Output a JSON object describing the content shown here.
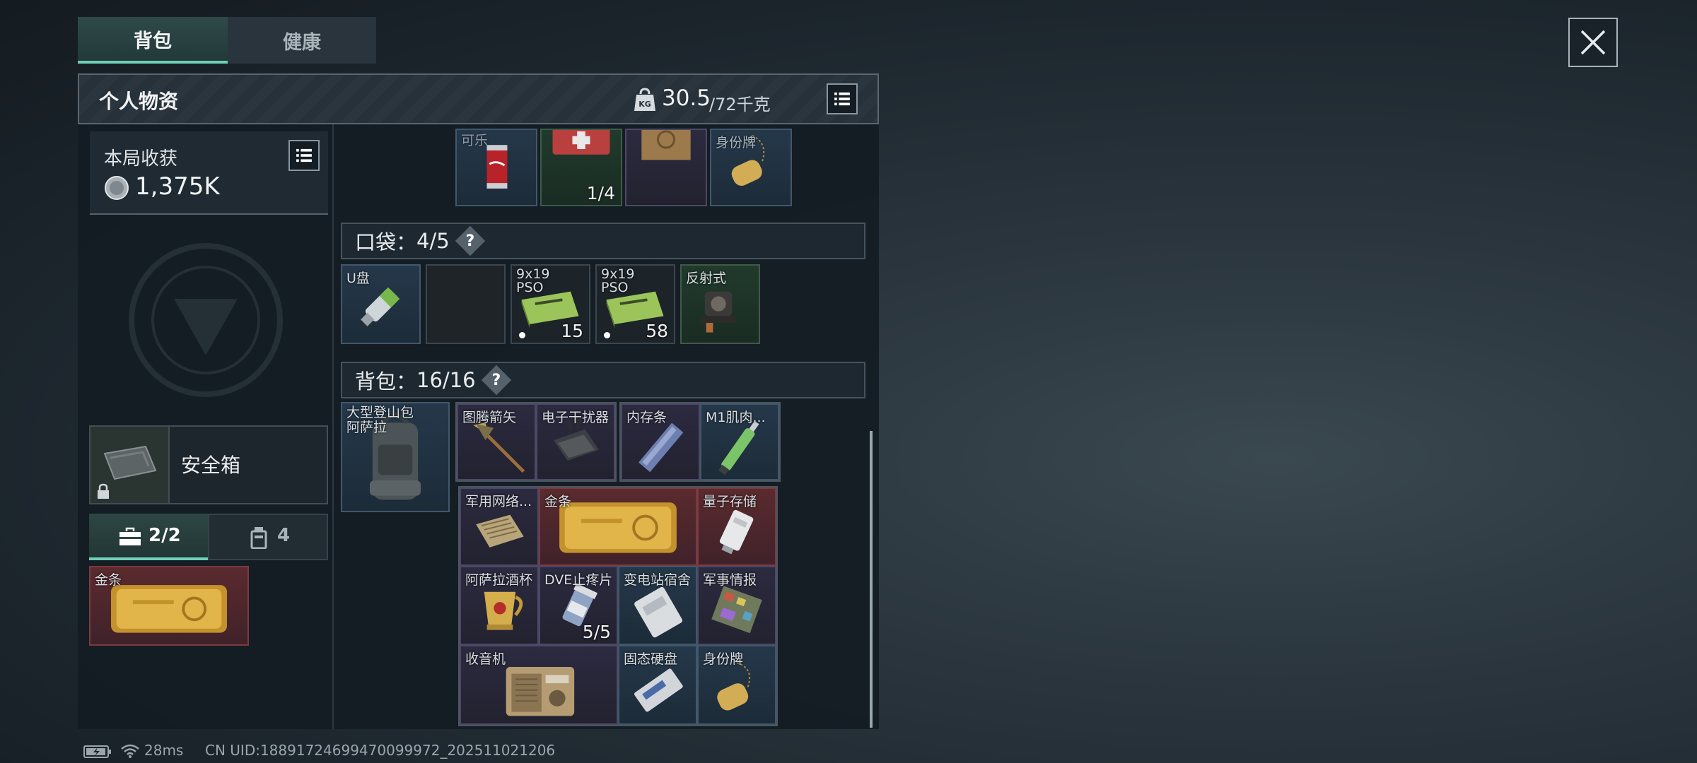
{
  "tabs": [
    {
      "label": "背包",
      "active": true
    },
    {
      "label": "健康",
      "active": false
    }
  ],
  "header": {
    "title": "个人物资",
    "weight_current": "30.5",
    "weight_max": "/72千克",
    "weight_icon": "kg-weight-icon"
  },
  "loot": {
    "label": "本局收获",
    "value": "1,375K"
  },
  "safebox": {
    "label": "安全箱"
  },
  "container_tabs": [
    {
      "value": "2/2",
      "icon": "toolbox-icon",
      "active": true
    },
    {
      "value": "4",
      "icon": "canister-icon",
      "active": false
    }
  ],
  "container_items": [
    {
      "label": "金条",
      "quality": "red"
    }
  ],
  "top_items": [
    {
      "label": "可乐",
      "count": "",
      "quality": "blue"
    },
    {
      "label": "",
      "count": "1/4",
      "quality": "green"
    },
    {
      "label": "",
      "count": "",
      "quality": "purple"
    },
    {
      "label": "身份牌",
      "count": "",
      "quality": "blue"
    }
  ],
  "pockets": {
    "label": "口袋：",
    "value": "4/5",
    "help": "?",
    "items": [
      {
        "label": "U盘",
        "count": "",
        "quality": "blue"
      },
      {
        "label": "",
        "count": "",
        "quality": "empty"
      },
      {
        "label": "9x19\nPSO",
        "count": "15",
        "quality": "gray"
      },
      {
        "label": "9x19\nPSO",
        "count": "58",
        "quality": "gray"
      },
      {
        "label": "反射式",
        "count": "",
        "quality": "green"
      }
    ]
  },
  "backpack": {
    "label": "背包：",
    "value": "16/16",
    "help": "?",
    "bag": {
      "label": "大型登山包\n阿萨拉"
    },
    "items": [
      {
        "label": "图腾箭矢",
        "count": ""
      },
      {
        "label": "电子干扰器",
        "count": ""
      },
      {
        "label": "内存条",
        "count": ""
      },
      {
        "label": "M1肌肉...",
        "count": ""
      },
      {
        "label": "军用网络...",
        "count": ""
      },
      {
        "label": "金条",
        "count": ""
      },
      {
        "label": "量子存储",
        "count": ""
      },
      {
        "label": "阿萨拉酒杯",
        "count": ""
      },
      {
        "label": "DVE止疼片",
        "count": "5/5"
      },
      {
        "label": "变电站宿舍",
        "count": ""
      },
      {
        "label": "军事情报",
        "count": ""
      },
      {
        "label": "收音机",
        "count": ""
      },
      {
        "label": "固态硬盘",
        "count": ""
      },
      {
        "label": "身份牌",
        "count": ""
      }
    ]
  },
  "status": {
    "ping": "28ms",
    "uid": "CN UID:18891724699470099972_202511021206"
  },
  "colors": {
    "accent": "#6fd1b4",
    "gold": "#d9a93a",
    "red_quality": "#5a2a2e"
  }
}
